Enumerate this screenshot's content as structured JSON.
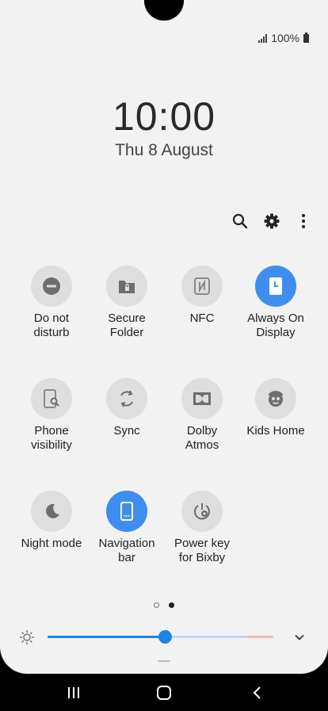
{
  "status": {
    "battery_text": "100%"
  },
  "lockscreen": {
    "time": "10:00",
    "date": "Thu 8 August"
  },
  "toolbar": {
    "search_icon": "search-icon",
    "settings_icon": "gear-icon",
    "more_icon": "more-vertical-icon"
  },
  "tiles": [
    {
      "id": "do-not-disturb",
      "label": "Do not\ndisturb",
      "icon": "minus-circle-icon",
      "active": false
    },
    {
      "id": "secure-folder",
      "label": "Secure\nFolder",
      "icon": "folder-lock-icon",
      "active": false
    },
    {
      "id": "nfc",
      "label": "NFC",
      "icon": "nfc-icon",
      "active": false
    },
    {
      "id": "always-on-display",
      "label": "Always On\nDisplay",
      "icon": "clock-screen-icon",
      "active": true
    },
    {
      "id": "phone-visibility",
      "label": "Phone\nvisibility",
      "icon": "phone-search-icon",
      "active": false
    },
    {
      "id": "sync",
      "label": "Sync",
      "icon": "sync-icon",
      "active": false
    },
    {
      "id": "dolby-atmos",
      "label": "Dolby\nAtmos",
      "icon": "dolby-icon",
      "active": false
    },
    {
      "id": "kids-home",
      "label": "Kids Home",
      "icon": "kids-face-icon",
      "active": false
    },
    {
      "id": "night-mode",
      "label": "Night mode",
      "icon": "moon-icon",
      "active": false
    },
    {
      "id": "navigation-bar",
      "label": "Navigation\nbar",
      "icon": "navigation-bar-icon",
      "active": true
    },
    {
      "id": "power-key-bixby",
      "label": "Power key\nfor Bixby",
      "icon": "power-bixby-icon",
      "active": false
    }
  ],
  "pager": {
    "pages": 2,
    "current": 2
  },
  "brightness": {
    "level": 0.52
  },
  "colors": {
    "accent": "#3d8ef0",
    "slider": "#1f82e8",
    "tile_off": "#dedede"
  }
}
